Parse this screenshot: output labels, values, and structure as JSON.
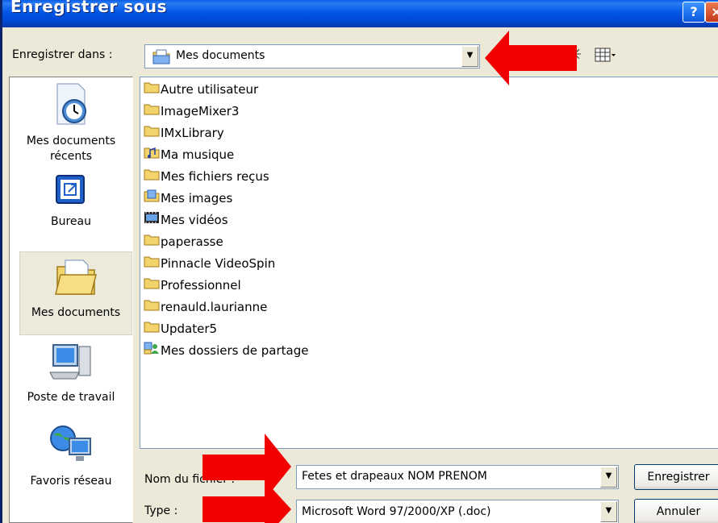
{
  "window": {
    "title": "Enregistrer sous",
    "help_button": "?",
    "close_button": "×"
  },
  "save_in": {
    "label": "Enregistrer dans :",
    "value": "Mes documents"
  },
  "places": [
    {
      "label_line1": "Mes documents",
      "label_line2": "récents",
      "icon": "recent-documents-icon"
    },
    {
      "label_line1": "Bureau",
      "label_line2": "",
      "icon": "desktop-icon"
    },
    {
      "label_line1": "Mes documents",
      "label_line2": "",
      "icon": "my-documents-icon",
      "selected": true
    },
    {
      "label_line1": "Poste de travail",
      "label_line2": "",
      "icon": "my-computer-icon"
    },
    {
      "label_line1": "Favoris réseau",
      "label_line2": "",
      "icon": "network-places-icon"
    }
  ],
  "files": [
    {
      "name": "Autre utilisateur",
      "icon": "folder-icon"
    },
    {
      "name": "ImageMixer3",
      "icon": "folder-icon"
    },
    {
      "name": "IMxLibrary",
      "icon": "folder-icon"
    },
    {
      "name": "Ma musique",
      "icon": "music-folder-icon"
    },
    {
      "name": "Mes fichiers reçus",
      "icon": "folder-icon"
    },
    {
      "name": "Mes images",
      "icon": "pictures-folder-icon"
    },
    {
      "name": "Mes vidéos",
      "icon": "videos-folder-icon"
    },
    {
      "name": "paperasse",
      "icon": "folder-icon"
    },
    {
      "name": "Pinnacle VideoSpin",
      "icon": "folder-icon"
    },
    {
      "name": "Professionnel",
      "icon": "folder-icon"
    },
    {
      "name": "renauld.laurianne",
      "icon": "folder-icon"
    },
    {
      "name": "Updater5",
      "icon": "folder-icon"
    },
    {
      "name": "Mes dossiers de partage",
      "icon": "shared-folder-icon"
    }
  ],
  "filename": {
    "label": "Nom du fichier :",
    "value": "Fetes et drapeaux NOM PRENOM"
  },
  "filetype": {
    "label": "Type :",
    "value": "Microsoft Word 97/2000/XP (.doc)"
  },
  "buttons": {
    "save": "Enregistrer",
    "cancel": "Annuler"
  },
  "colors": {
    "annotation_arrow": "#f20000",
    "titlebar": "#0055e5",
    "dialog_bg": "#ece9d8"
  }
}
